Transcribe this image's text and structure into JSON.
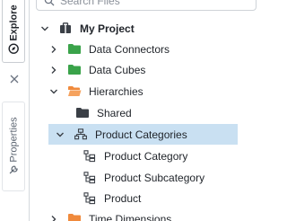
{
  "colors": {
    "folder_green": "#3aa34a",
    "folder_orange": "#f08a3c",
    "folder_dark": "#3a3f46",
    "selected_bg": "#c9e0f2"
  },
  "side_tabs": [
    {
      "label": "Explore",
      "icon": "compass-icon",
      "active": true
    },
    {
      "label": "Properties",
      "icon": "wrench-icon",
      "active": false
    }
  ],
  "search": {
    "placeholder": "Search Files"
  },
  "tree": {
    "project": {
      "label": "My Project",
      "icon": "briefcase-icon",
      "expanded": true
    },
    "items": [
      {
        "label": "Data Connectors",
        "icon": "folder-green-icon",
        "expanded": false
      },
      {
        "label": "Data Cubes",
        "icon": "folder-green-icon",
        "expanded": false
      },
      {
        "label": "Hierarchies",
        "icon": "folder-orange-icon",
        "expanded": true
      },
      {
        "label": "Shared",
        "icon": "folder-dark-icon"
      },
      {
        "label": "Product Categories",
        "icon": "hierarchy-icon",
        "expanded": true,
        "selected": true
      },
      {
        "label": "Product Category",
        "icon": "level-icon"
      },
      {
        "label": "Product Subcategory",
        "icon": "level-icon"
      },
      {
        "label": "Product",
        "icon": "level-icon"
      },
      {
        "label": "Time Dimensions",
        "icon": "folder-orange-icon",
        "expanded": false
      }
    ]
  }
}
